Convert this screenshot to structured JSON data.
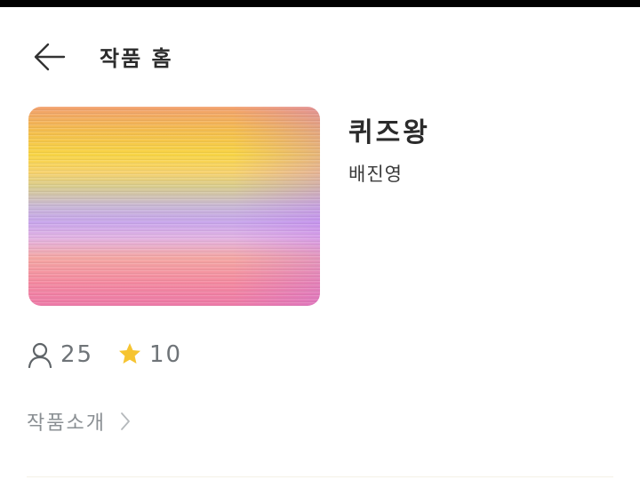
{
  "header": {
    "title": "작품 홈",
    "back_icon": "arrow-left-icon"
  },
  "work": {
    "title": "퀴즈왕",
    "author": "배진영"
  },
  "stats": {
    "readers": "25",
    "readers_icon": "person-icon",
    "likes": "10",
    "likes_icon": "star-icon",
    "star_color": "#f6c431"
  },
  "intro": {
    "label": "작품소개",
    "chevron_icon": "chevron-right-icon"
  }
}
